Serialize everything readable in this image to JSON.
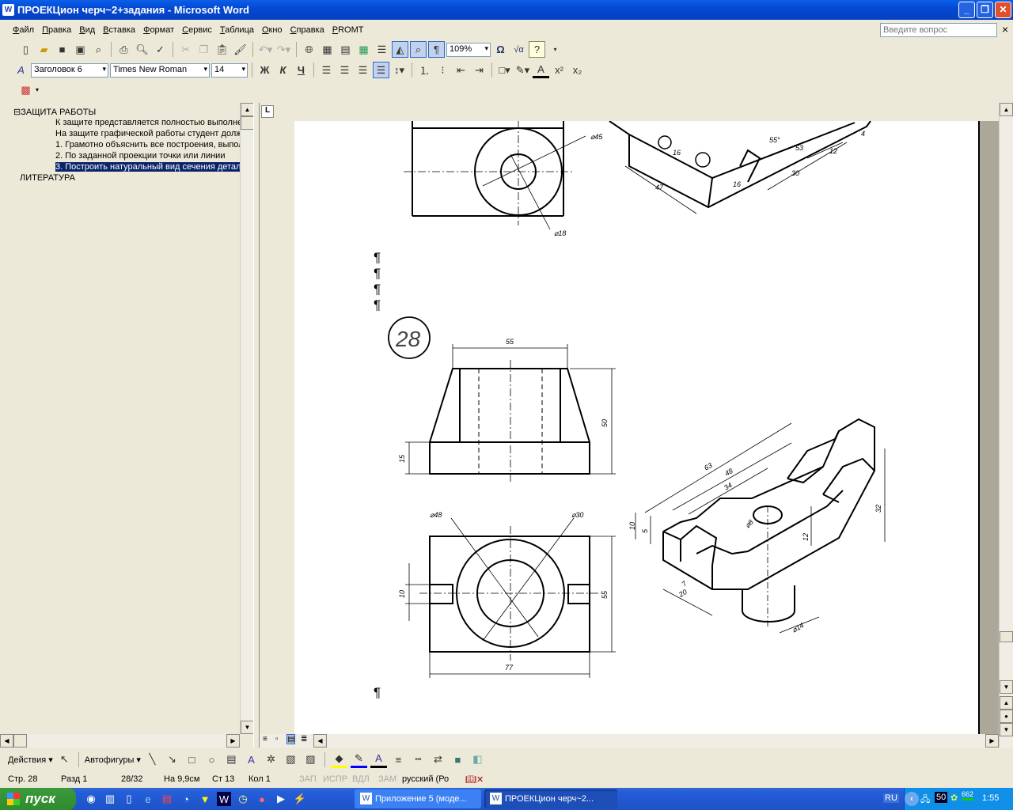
{
  "window": {
    "title": "ПРОЕКЦион черч~2+задания - Microsoft Word",
    "minimize": "_",
    "maximize": "❐",
    "close": "✕"
  },
  "menu": [
    "Файл",
    "Правка",
    "Вид",
    "Вставка",
    "Формат",
    "Сервис",
    "Таблица",
    "Окно",
    "Справка",
    "PROMT"
  ],
  "help_box": {
    "placeholder": "Введите вопрос",
    "close": "×"
  },
  "toolbar": {
    "zoom": "109%",
    "style": "Заголовок 6",
    "font": "Times New Roman",
    "size": "14",
    "bold": "Ж",
    "italic": "К",
    "underline": "Ч",
    "pilcrow": "¶",
    "omega": "Ω",
    "sqrt": "√α",
    "help": "?"
  },
  "outline": {
    "heading": "⊟ЗАЩИТА РАБОТЫ",
    "items": [
      "К защите представляется полностью выполненная",
      "На защите графической работы студент должен",
      "1. Грамотно объяснить все построения, выполненные",
      "2. По заданной проекции точки или линии",
      "3. Построить натуральный вид сечения детали"
    ],
    "heading2": "ЛИТЕРАТУРА"
  },
  "ruler_tab": "L",
  "document": {
    "pilcrow": "¶",
    "task_number": "28",
    "top_dims": [
      "⌀45",
      "⌀18",
      "16",
      "55°",
      "53",
      "12",
      "4",
      "30",
      "16",
      "47"
    ],
    "front_dims": {
      "width": "55",
      "height": "50",
      "base": "15"
    },
    "plan_dims": {
      "outer": "⌀48",
      "inner": "⌀30",
      "slot": "10",
      "depth": "55",
      "width": "77"
    },
    "iso_dims": [
      "63",
      "48",
      "34",
      "10",
      "5",
      "⌀8",
      "12",
      "32",
      "7",
      "20",
      "⌀14"
    ]
  },
  "drawing_toolbar": {
    "actions": "Действия ▾",
    "autoshapes": "Автофигуры ▾"
  },
  "status": {
    "page": "Стр. 28",
    "section": "Разд 1",
    "pages": "28/32",
    "at": "На 9,9см",
    "line": "Ст 13",
    "col": "Кол 1",
    "rec": "ЗАП",
    "trk": "ИСПР",
    "ext": "ВДЛ",
    "ovr": "ЗАМ",
    "lang": "русский (Ро"
  },
  "taskbar": {
    "start": "пуск",
    "tasks": [
      "Приложение 5 (моде...",
      "ПРОЕКЦион черч~2..."
    ],
    "lang": "RU",
    "tray_num": "50",
    "tray_val": "662",
    "clock": "1:55"
  }
}
